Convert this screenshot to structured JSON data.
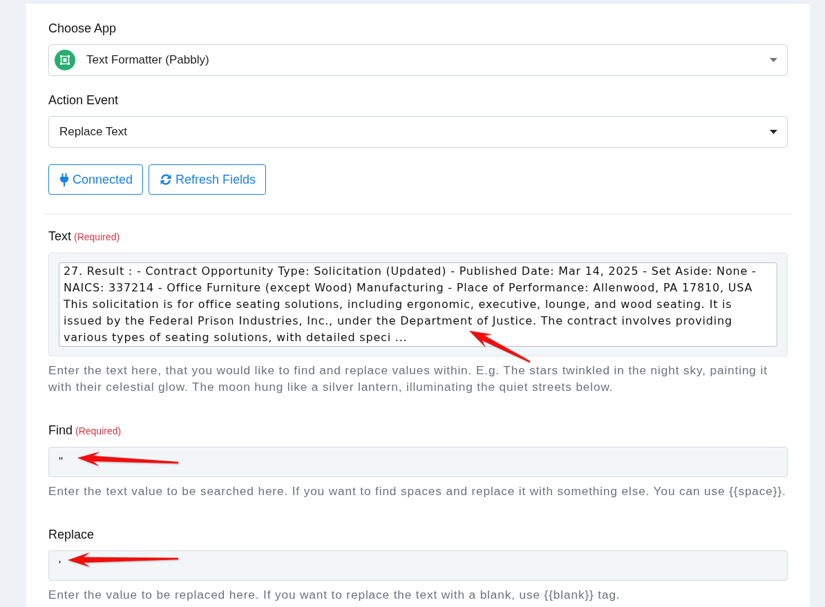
{
  "choose_app": {
    "label": "Choose App",
    "value": "Text Formatter (Pabbly)"
  },
  "action_event": {
    "label": "Action Event",
    "value": "Replace Text"
  },
  "buttons": [
    {
      "kind": "connected",
      "label": "Connected"
    },
    {
      "kind": "refresh",
      "label": "Refresh Fields"
    }
  ],
  "fields": [
    {
      "kind": "textarea",
      "label": "Text",
      "required_note": "(Required)",
      "value": "27. Result : - Contract Opportunity Type: Solicitation (Updated) - Published Date: Mar 14, 2025 - Set Aside: None - NAICS: 337214 - Office Furniture (except Wood) Manufacturing - Place of Performance: Allenwood, PA 17810, USA This solicitation is for office seating solutions, including ergonomic, executive, lounge, and wood seating. It is issued by the Federal Prison Industries, Inc., under the Department of Justice. The contract involves providing various types of seating solutions, with detailed speci ...",
      "help": "Enter the text here, that you would like to find and replace values within. E.g. The stars twinkled in the night sky, painting it with their celestial glow. The moon hung like a silver lantern, illuminating the quiet streets below.",
      "arrow": true
    },
    {
      "kind": "input",
      "label": "Find",
      "required_note": "(Required)",
      "value": "\"",
      "help": "Enter the text value to be searched here. If you want to find spaces and replace it with something else. You can use {{space}}.",
      "arrow": true
    },
    {
      "kind": "input",
      "label": "Replace",
      "value": "'",
      "help": "Enter the value to be replaced here. If you want to replace the text with a blank, use {{blank}} tag.",
      "arrow": true
    }
  ]
}
